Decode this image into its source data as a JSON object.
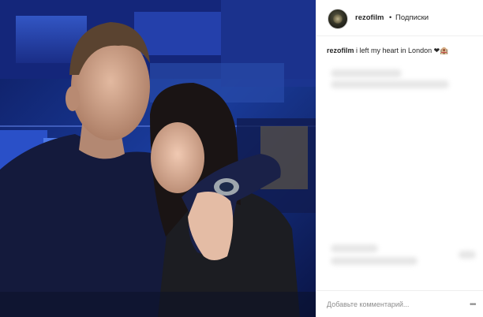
{
  "post": {
    "username": "rezofilm",
    "separator": "•",
    "follow_label": "Подписки",
    "caption_user": "rezofilm",
    "caption_text": "i left my heart in London",
    "caption_emoji": "❤🏨"
  },
  "comment": {
    "placeholder": "Добавьте комментарий..."
  },
  "icons": {
    "avatar": "avatar",
    "more": "more-options-icon"
  },
  "colors": {
    "text": "#262626",
    "muted": "#8e8e8e",
    "border": "#efefef"
  }
}
